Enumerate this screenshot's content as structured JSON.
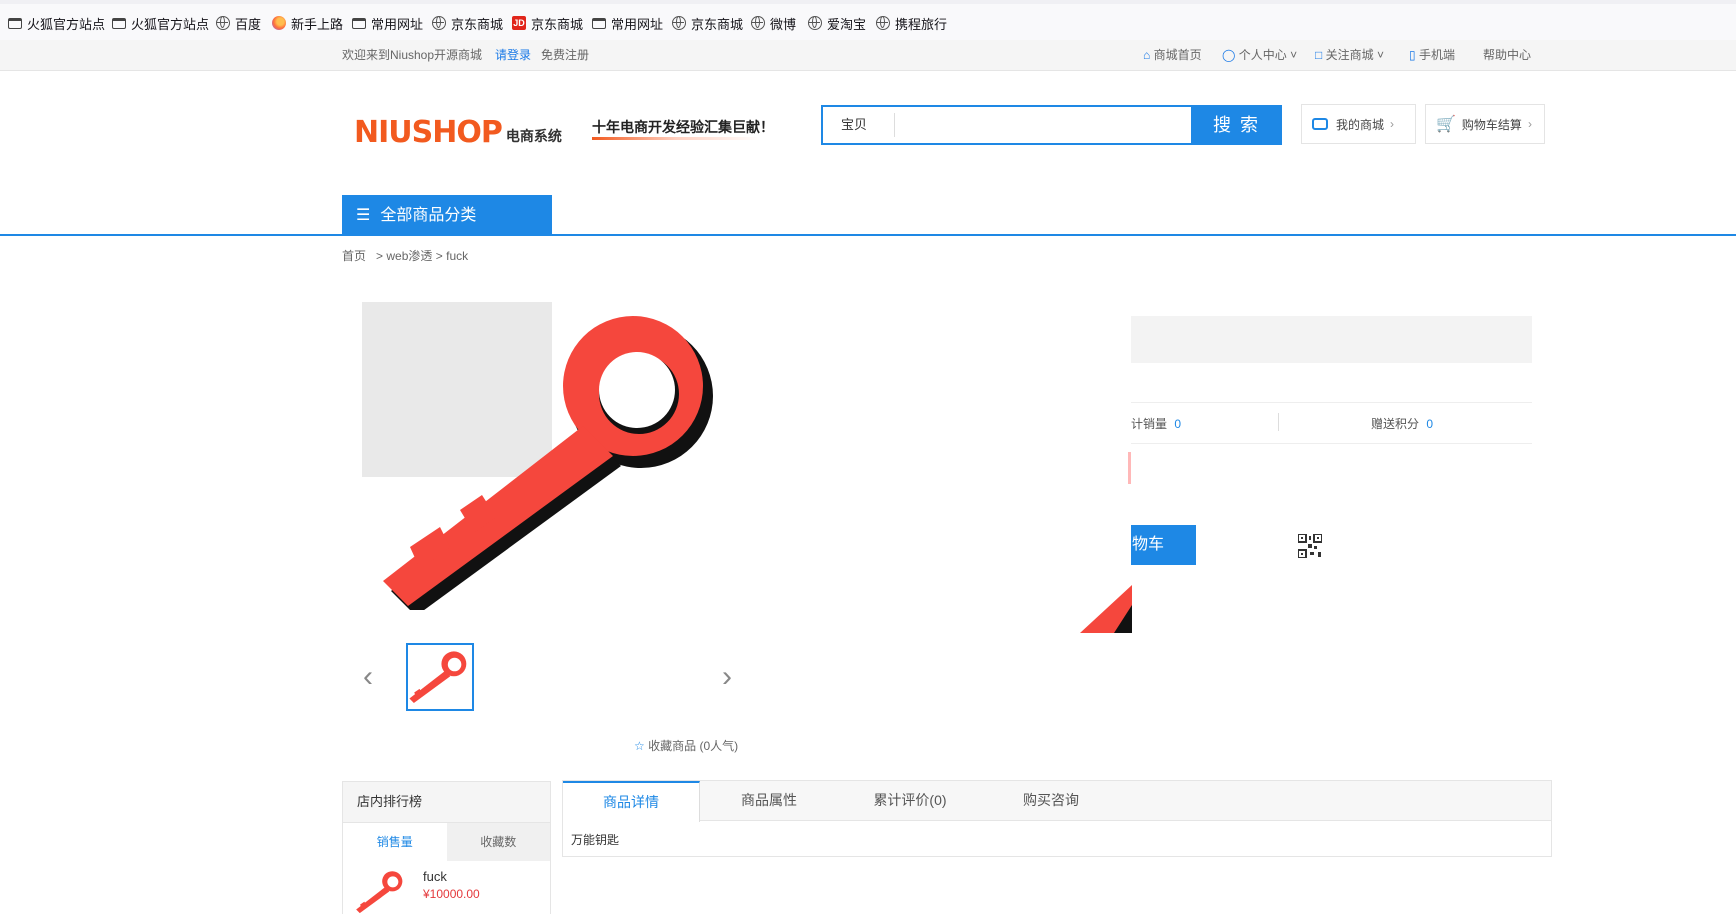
{
  "bookmarks": [
    {
      "label": "火狐官方站点",
      "icon": "folder-icon"
    },
    {
      "label": "火狐官方站点",
      "icon": "folder-icon"
    },
    {
      "label": "百度",
      "icon": "globe-icon"
    },
    {
      "label": "新手上路",
      "icon": "firefox-icon"
    },
    {
      "label": "常用网址",
      "icon": "folder-icon"
    },
    {
      "label": "京东商城",
      "icon": "globe-icon"
    },
    {
      "label": "京东商城",
      "icon": "jd-icon"
    },
    {
      "label": "常用网址",
      "icon": "folder-icon"
    },
    {
      "label": "京东商城",
      "icon": "globe-icon"
    },
    {
      "label": "微博",
      "icon": "globe-icon"
    },
    {
      "label": "爱淘宝",
      "icon": "globe-icon"
    },
    {
      "label": "携程旅行",
      "icon": "globe-icon"
    }
  ],
  "topbar": {
    "welcome": "欢迎来到Niushop开源商城",
    "login": "请登录",
    "register": "免费注册",
    "links": [
      "商城首页",
      "个人中心",
      "关注商城",
      "手机端",
      "帮助中心"
    ]
  },
  "header": {
    "logo": "NIUSHOP",
    "logo_sub": "电商系统",
    "slogan": "十年电商开发经验汇集巨献！",
    "search_scope": "宝贝",
    "search_value": "",
    "search_button": "搜 索",
    "my_mall": "我的商城",
    "cart": "购物车结算"
  },
  "nav": {
    "all_categories": "全部商品分类"
  },
  "breadcrumb": {
    "home": "首页",
    "sep1": ">",
    "category": "web渗透",
    "sep2": ">",
    "product": "fuck"
  },
  "product": {
    "sales_label": "计销量",
    "sales_value": "0",
    "points_label": "赠送积分",
    "points_value": "0",
    "cart_button_partial": "购物车",
    "favorite": "收藏商品 (0人气)"
  },
  "sidebar": {
    "title": "店内排行榜",
    "tabs": [
      "销售量",
      "收藏数"
    ],
    "items": [
      {
        "name": "fuck",
        "price": "¥10000.00"
      }
    ]
  },
  "detail_tabs": [
    "商品详情",
    "商品属性",
    "累计评价(0)",
    "购买咨询"
  ],
  "detail_content": "万能钥匙",
  "colors": {
    "accent": "#1e88e5",
    "price": "#e4393c",
    "key_red": "#f5473d"
  }
}
